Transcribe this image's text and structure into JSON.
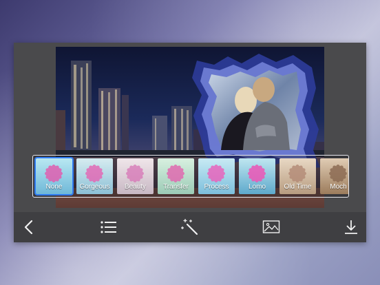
{
  "filters": [
    {
      "label": "None",
      "active": true,
      "tint_top": "#b9e8f2",
      "tint_bottom": "#6fb8d8"
    },
    {
      "label": "Gorgeous",
      "active": false,
      "tint_top": "#d6ecf0",
      "tint_bottom": "#8cc0d6"
    },
    {
      "label": "Beauty",
      "active": false,
      "tint_top": "#f0e6ea",
      "tint_bottom": "#c8b8c4"
    },
    {
      "label": "Transfer",
      "active": false,
      "tint_top": "#d8f0e0",
      "tint_bottom": "#9ccbb6"
    },
    {
      "label": "Process",
      "active": false,
      "tint_top": "#c8eaf4",
      "tint_bottom": "#7dbfdc"
    },
    {
      "label": "Lomo",
      "active": false,
      "tint_top": "#bfe6f0",
      "tint_bottom": "#5ea9cc"
    },
    {
      "label": "Old Time",
      "active": false,
      "tint_top": "#e8d8c4",
      "tint_bottom": "#b89c80"
    },
    {
      "label": "Moch",
      "active": false,
      "tint_top": "#e0ccb4",
      "tint_bottom": "#9c7c5c"
    }
  ],
  "toolbar": {
    "icons": [
      "back-chevron-icon",
      "list-icon",
      "magic-wand-icon",
      "image-icon",
      "download-icon"
    ]
  },
  "colors": {
    "accent": "#2f7bf2",
    "frame_border": "#3b49a8"
  }
}
